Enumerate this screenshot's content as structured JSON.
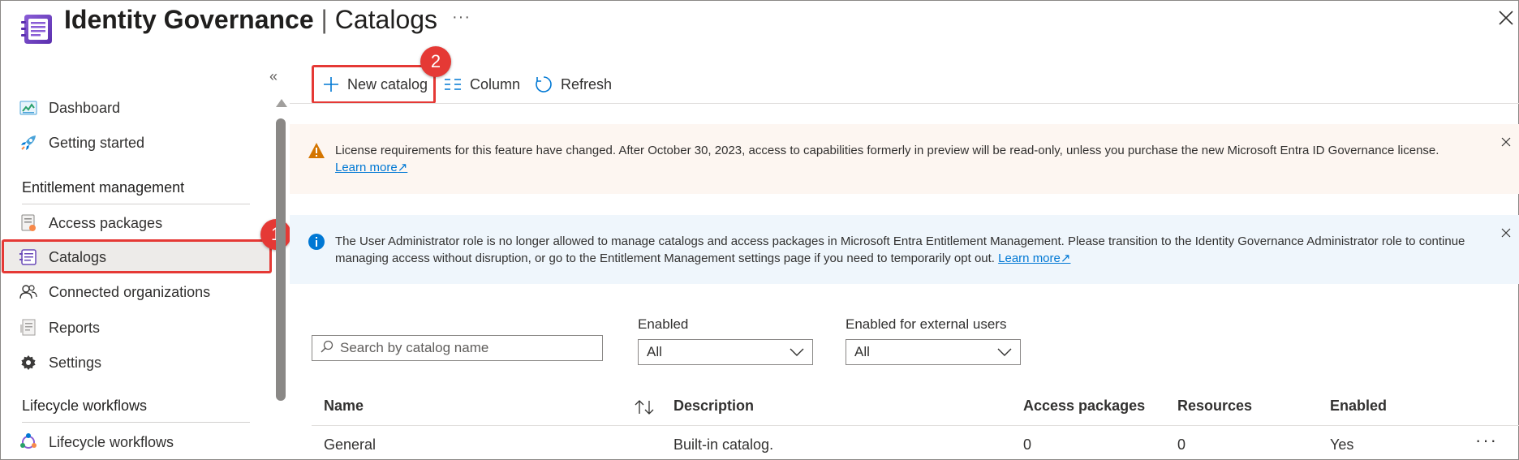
{
  "header": {
    "title_main": "Identity Governance",
    "title_sep": "|",
    "title_page": "Catalogs",
    "more_label": "···",
    "icons": {
      "app": "identity-governance-icon",
      "close": "close-icon"
    }
  },
  "sidebar": {
    "collapse_label": "«",
    "items": [
      {
        "label": "Dashboard",
        "icon": "dashboard-icon"
      },
      {
        "label": "Getting started",
        "icon": "rocket-icon"
      }
    ],
    "sections": [
      {
        "title": "Entitlement management",
        "items": [
          {
            "label": "Access packages",
            "icon": "access-package-icon"
          },
          {
            "label": "Catalogs",
            "icon": "catalog-icon",
            "selected": true
          },
          {
            "label": "Connected organizations",
            "icon": "people-icon"
          },
          {
            "label": "Reports",
            "icon": "report-icon"
          },
          {
            "label": "Settings",
            "icon": "gear-icon"
          }
        ]
      },
      {
        "title": "Lifecycle workflows",
        "items": [
          {
            "label": "Lifecycle workflows",
            "icon": "workflow-icon"
          }
        ]
      }
    ]
  },
  "annotations": {
    "badge1": "1",
    "badge2": "2"
  },
  "toolbar": {
    "new_catalog": "New catalog",
    "column": "Column",
    "refresh": "Refresh"
  },
  "banners": {
    "warning": {
      "text": "License requirements for this feature have changed. After October 30, 2023, access to capabilities formerly in preview will be read-only, unless you purchase the new Microsoft Entra ID Governance license.",
      "link": "Learn more"
    },
    "info": {
      "text": "The User Administrator role is no longer allowed to manage catalogs and access packages in Microsoft Entra Entitlement Management. Please transition to the Identity Governance Administrator role to continue managing access without disruption, or go to the Entitlement Management settings page if you need to temporarily opt out.",
      "link": "Learn more"
    }
  },
  "filters": {
    "search_placeholder": "Search by catalog name",
    "enabled": {
      "label": "Enabled",
      "value": "All"
    },
    "enabled_external": {
      "label": "Enabled for external users",
      "value": "All"
    }
  },
  "table": {
    "columns": [
      "Name",
      "Description",
      "Access packages",
      "Resources",
      "Enabled"
    ],
    "rows": [
      {
        "name": "General",
        "description": "Built-in catalog.",
        "access_packages": "0",
        "resources": "0",
        "enabled": "Yes"
      }
    ],
    "row_more": "···"
  },
  "colors": {
    "accent": "#0078d4",
    "annotation_red": "#e53935",
    "warning_bg": "#fdf6f1",
    "info_bg": "#eff6fc"
  }
}
